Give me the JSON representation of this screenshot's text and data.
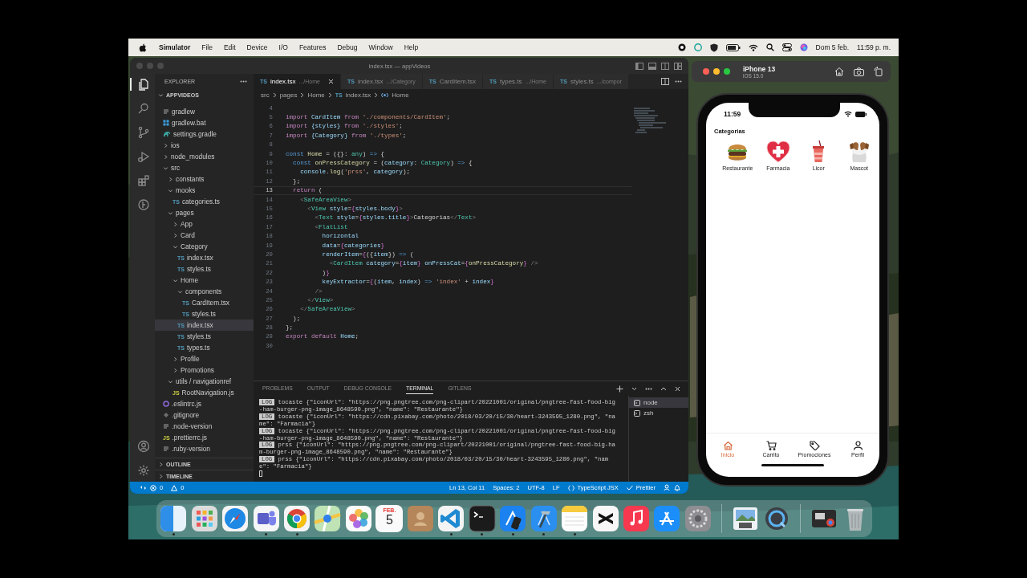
{
  "menubar": {
    "app": "Simulator",
    "menus": [
      "File",
      "Edit",
      "Device",
      "I/O",
      "Features",
      "Debug",
      "Window",
      "Help"
    ],
    "date": "Dom 5 feb.",
    "time": "11:59 p. m."
  },
  "vscode": {
    "title": "index.tsx — appVideos",
    "activity": {
      "top": [
        {
          "kind": "files",
          "selected": true
        },
        {
          "kind": "search",
          "selected": false
        },
        {
          "kind": "source-control",
          "selected": false
        },
        {
          "kind": "run",
          "selected": false
        },
        {
          "kind": "extensions",
          "selected": false
        },
        {
          "kind": "gitlens",
          "selected": false
        }
      ],
      "bottom": [
        {
          "kind": "account",
          "selected": false
        },
        {
          "kind": "settings",
          "selected": false
        }
      ]
    },
    "explorer": {
      "title": "EXPLORER",
      "root": {
        "label": "APPVIDEOS",
        "expanded": true
      },
      "items": [
        {
          "label": "gradlew",
          "kind": "text",
          "selected": false
        },
        {
          "label": "gradlew.bat",
          "kind": "windows",
          "selected": false
        },
        {
          "label": "settings.gradle",
          "kind": "gradle",
          "selected": false
        },
        {
          "label": "ios",
          "kind": "folder",
          "expanded": false,
          "selected": false
        },
        {
          "label": "node_modules",
          "kind": "folder",
          "expanded": false,
          "selected": false
        },
        {
          "label": "src",
          "kind": "folder",
          "expanded": true,
          "selected": false,
          "children": [
            {
              "label": "constants",
              "kind": "folder",
              "expanded": false,
              "selected": false
            },
            {
              "label": "mooks",
              "kind": "folder",
              "expanded": true,
              "selected": false,
              "children": [
                {
                  "label": "categories.ts",
                  "kind": "ts",
                  "badge": "TS",
                  "selected": false
                }
              ]
            },
            {
              "label": "pages",
              "kind": "folder",
              "expanded": true,
              "selected": false,
              "children": [
                {
                  "label": "App",
                  "kind": "folder",
                  "expanded": false,
                  "selected": false
                },
                {
                  "label": "Card",
                  "kind": "folder",
                  "expanded": false,
                  "selected": false
                },
                {
                  "label": "Category",
                  "kind": "folder",
                  "expanded": true,
                  "selected": false,
                  "children": [
                    {
                      "label": "index.tsx",
                      "kind": "ts",
                      "badge": "TS",
                      "selected": false
                    },
                    {
                      "label": "styles.ts",
                      "kind": "ts",
                      "badge": "TS",
                      "selected": false
                    }
                  ]
                },
                {
                  "label": "Home",
                  "kind": "folder",
                  "expanded": true,
                  "selected": false,
                  "children": [
                    {
                      "label": "components",
                      "kind": "folder",
                      "expanded": true,
                      "selected": false,
                      "children": [
                        {
                          "label": "CardItem.tsx",
                          "kind": "ts",
                          "badge": "TS",
                          "selected": false
                        },
                        {
                          "label": "styles.ts",
                          "kind": "ts",
                          "badge": "TS",
                          "selected": false
                        }
                      ]
                    },
                    {
                      "label": "index.tsx",
                      "kind": "ts",
                      "badge": "TS",
                      "selected": true
                    },
                    {
                      "label": "styles.ts",
                      "kind": "ts",
                      "badge": "TS",
                      "selected": false
                    },
                    {
                      "label": "types.ts",
                      "kind": "ts",
                      "badge": "TS",
                      "selected": false
                    }
                  ]
                },
                {
                  "label": "Profile",
                  "kind": "folder",
                  "expanded": false,
                  "selected": false
                },
                {
                  "label": "Promotions",
                  "kind": "folder",
                  "expanded": false,
                  "selected": false
                }
              ]
            },
            {
              "label": "utils / navigationref",
              "kind": "folder",
              "expanded": true,
              "selected": false,
              "children": [
                {
                  "label": "RootNavigation.js",
                  "kind": "js",
                  "badge": "JS",
                  "selected": false
                }
              ]
            }
          ]
        },
        {
          "label": ".eslintrc.js",
          "kind": "eslint",
          "selected": false
        },
        {
          "label": ".gitignore",
          "kind": "git",
          "selected": false
        },
        {
          "label": ".node-version",
          "kind": "text",
          "selected": false
        },
        {
          "label": ".prettierrc.js",
          "kind": "js",
          "badge": "JS",
          "selected": false
        },
        {
          "label": ".ruby-version",
          "kind": "text",
          "selected": false
        }
      ],
      "sections": [
        {
          "label": "OUTLINE",
          "expanded": false
        },
        {
          "label": "TIMELINE",
          "expanded": false
        }
      ]
    },
    "tabs": [
      {
        "badge": "TS",
        "label": "index.tsx",
        "detail": ".../Home",
        "selected": true
      },
      {
        "badge": "TS",
        "label": "index.tsx",
        "detail": ".../Category",
        "selected": false
      },
      {
        "badge": "TS",
        "label": "CardItem.tsx",
        "selected": false
      },
      {
        "badge": "TS",
        "label": "types.ts",
        "detail": ".../Home",
        "selected": false
      },
      {
        "badge": "TS",
        "label": "styles.ts",
        "detail": ".../compor",
        "selected": false
      }
    ],
    "breadcrumb": [
      {
        "label": "src",
        "kind": "folder"
      },
      {
        "label": "pages",
        "kind": "folder"
      },
      {
        "label": "Home",
        "kind": "folder"
      },
      {
        "label": "index.tsx",
        "kind": "file",
        "badge": "TS"
      },
      {
        "label": "Home",
        "kind": "symbol"
      }
    ],
    "code": [
      {
        "number": "4",
        "current": false
      },
      {
        "number": "5",
        "current": false,
        "tokens": [
          {
            "text": "import ",
            "kind": "kw"
          },
          {
            "text": "CardItem ",
            "kind": "var"
          },
          {
            "text": "from ",
            "kind": "kw"
          },
          {
            "text": "'./components/CardItem'",
            "kind": "str"
          },
          {
            "text": ";",
            "kind": "txt"
          }
        ]
      },
      {
        "number": "6",
        "current": false,
        "tokens": [
          {
            "text": "import ",
            "kind": "kw"
          },
          {
            "text": "{styles} ",
            "kind": "var"
          },
          {
            "text": "from ",
            "kind": "kw"
          },
          {
            "text": "'./styles'",
            "kind": "str"
          },
          {
            "text": ";",
            "kind": "txt"
          }
        ]
      },
      {
        "number": "7",
        "current": false,
        "tokens": [
          {
            "text": "import ",
            "kind": "kw"
          },
          {
            "text": "{Category} ",
            "kind": "var"
          },
          {
            "text": "from ",
            "kind": "kw"
          },
          {
            "text": "'./types'",
            "kind": "str"
          },
          {
            "text": ";",
            "kind": "txt"
          }
        ]
      },
      {
        "number": "8",
        "current": false
      },
      {
        "number": "9",
        "current": false,
        "tokens": [
          {
            "text": "const ",
            "kind": "st"
          },
          {
            "text": "Home",
            "kind": "fn"
          },
          {
            "text": " = ({}: ",
            "kind": "txt"
          },
          {
            "text": "any",
            "kind": "type"
          },
          {
            "text": ") ",
            "kind": "txt"
          },
          {
            "text": "=>",
            "kind": "st"
          },
          {
            "text": " {",
            "kind": "txt"
          }
        ]
      },
      {
        "number": "10",
        "current": false,
        "tokens": [
          {
            "text": "  const ",
            "kind": "st"
          },
          {
            "text": "onPressCategory",
            "kind": "fn"
          },
          {
            "text": " = (",
            "kind": "txt"
          },
          {
            "text": "category",
            "kind": "var"
          },
          {
            "text": ": ",
            "kind": "txt"
          },
          {
            "text": "Category",
            "kind": "type"
          },
          {
            "text": ") ",
            "kind": "txt"
          },
          {
            "text": "=>",
            "kind": "st"
          },
          {
            "text": " {",
            "kind": "txt"
          }
        ]
      },
      {
        "number": "11",
        "current": false,
        "tokens": [
          {
            "text": "    console",
            "kind": "var"
          },
          {
            "text": ".",
            "kind": "txt"
          },
          {
            "text": "log",
            "kind": "fn"
          },
          {
            "text": "(",
            "kind": "txt"
          },
          {
            "text": "'prss'",
            "kind": "str"
          },
          {
            "text": ", ",
            "kind": "txt"
          },
          {
            "text": "category",
            "kind": "var"
          },
          {
            "text": ");",
            "kind": "txt"
          }
        ]
      },
      {
        "number": "12",
        "current": false,
        "tokens": [
          {
            "text": "  };",
            "kind": "txt"
          }
        ]
      },
      {
        "number": "13",
        "current": true,
        "tokens": [
          {
            "text": "  return ",
            "kind": "kw"
          },
          {
            "text": "(",
            "kind": "txt"
          }
        ]
      },
      {
        "number": "14",
        "current": false,
        "tokens": [
          {
            "text": "    <",
            "kind": "pun"
          },
          {
            "text": "SafeAreaView",
            "kind": "type"
          },
          {
            "text": ">",
            "kind": "pun"
          }
        ]
      },
      {
        "number": "15",
        "current": false,
        "tokens": [
          {
            "text": "      <",
            "kind": "pun"
          },
          {
            "text": "View ",
            "kind": "type"
          },
          {
            "text": "style",
            "kind": "var"
          },
          {
            "text": "=",
            "kind": "txt"
          },
          {
            "text": "{",
            "kind": "br"
          },
          {
            "text": "styles.body",
            "kind": "var"
          },
          {
            "text": "}",
            "kind": "br"
          },
          {
            "text": ">",
            "kind": "pun"
          }
        ]
      },
      {
        "number": "16",
        "current": false,
        "tokens": [
          {
            "text": "        <",
            "kind": "pun"
          },
          {
            "text": "Text ",
            "kind": "type"
          },
          {
            "text": "style",
            "kind": "var"
          },
          {
            "text": "=",
            "kind": "txt"
          },
          {
            "text": "{",
            "kind": "br"
          },
          {
            "text": "styles.title",
            "kind": "var"
          },
          {
            "text": "}",
            "kind": "br"
          },
          {
            "text": ">",
            "kind": "pun"
          },
          {
            "text": "Categorias",
            "kind": "txt"
          },
          {
            "text": "</",
            "kind": "pun"
          },
          {
            "text": "Text",
            "kind": "type"
          },
          {
            "text": ">",
            "kind": "pun"
          }
        ]
      },
      {
        "number": "17",
        "current": false,
        "tokens": [
          {
            "text": "        <",
            "kind": "pun"
          },
          {
            "text": "FlatList",
            "kind": "type"
          }
        ]
      },
      {
        "number": "18",
        "current": false,
        "tokens": [
          {
            "text": "          horizontal",
            "kind": "var"
          }
        ]
      },
      {
        "number": "19",
        "current": false,
        "tokens": [
          {
            "text": "          data",
            "kind": "var"
          },
          {
            "text": "=",
            "kind": "txt"
          },
          {
            "text": "{",
            "kind": "br"
          },
          {
            "text": "categories",
            "kind": "var"
          },
          {
            "text": "}",
            "kind": "br"
          }
        ]
      },
      {
        "number": "20",
        "current": false,
        "tokens": [
          {
            "text": "          renderItem",
            "kind": "var"
          },
          {
            "text": "=",
            "kind": "txt"
          },
          {
            "text": "{",
            "kind": "br"
          },
          {
            "text": "({",
            "kind": "txt"
          },
          {
            "text": "item",
            "kind": "var"
          },
          {
            "text": "}) ",
            "kind": "txt"
          },
          {
            "text": "=>",
            "kind": "st"
          },
          {
            "text": " (",
            "kind": "txt"
          }
        ]
      },
      {
        "number": "21",
        "current": false,
        "tokens": [
          {
            "text": "            <",
            "kind": "pun"
          },
          {
            "text": "CardItem ",
            "kind": "type"
          },
          {
            "text": "category",
            "kind": "var"
          },
          {
            "text": "=",
            "kind": "txt"
          },
          {
            "text": "{",
            "kind": "br"
          },
          {
            "text": "item",
            "kind": "var"
          },
          {
            "text": "} ",
            "kind": "br"
          },
          {
            "text": "onPressCat",
            "kind": "var"
          },
          {
            "text": "=",
            "kind": "txt"
          },
          {
            "text": "{",
            "kind": "br"
          },
          {
            "text": "onPressCategory",
            "kind": "fn"
          },
          {
            "text": "} ",
            "kind": "br"
          },
          {
            "text": "/>",
            "kind": "pun"
          }
        ]
      },
      {
        "number": "22",
        "current": false,
        "tokens": [
          {
            "text": "          )",
            "kind": "txt"
          },
          {
            "text": "}",
            "kind": "br"
          }
        ]
      },
      {
        "number": "23",
        "current": false,
        "tokens": [
          {
            "text": "          keyExtractor",
            "kind": "var"
          },
          {
            "text": "=",
            "kind": "txt"
          },
          {
            "text": "{",
            "kind": "br"
          },
          {
            "text": "(",
            "kind": "txt"
          },
          {
            "text": "item",
            "kind": "var"
          },
          {
            "text": ", ",
            "kind": "txt"
          },
          {
            "text": "index",
            "kind": "var"
          },
          {
            "text": ") ",
            "kind": "txt"
          },
          {
            "text": "=> ",
            "kind": "st"
          },
          {
            "text": "'index'",
            "kind": "str"
          },
          {
            "text": " + ",
            "kind": "txt"
          },
          {
            "text": "index",
            "kind": "var"
          },
          {
            "text": "}",
            "kind": "br"
          }
        ]
      },
      {
        "number": "24",
        "current": false,
        "tokens": [
          {
            "text": "        />",
            "kind": "pun"
          }
        ]
      },
      {
        "number": "25",
        "current": false,
        "tokens": [
          {
            "text": "      </",
            "kind": "pun"
          },
          {
            "text": "View",
            "kind": "type"
          },
          {
            "text": ">",
            "kind": "pun"
          }
        ]
      },
      {
        "number": "26",
        "current": false,
        "tokens": [
          {
            "text": "    </",
            "kind": "pun"
          },
          {
            "text": "SafeAreaView",
            "kind": "type"
          },
          {
            "text": ">",
            "kind": "pun"
          }
        ]
      },
      {
        "number": "27",
        "current": false,
        "tokens": [
          {
            "text": "  );",
            "kind": "txt"
          }
        ]
      },
      {
        "number": "28",
        "current": false,
        "tokens": [
          {
            "text": "};",
            "kind": "txt"
          }
        ]
      },
      {
        "number": "29",
        "current": false,
        "tokens": [
          {
            "text": "export default ",
            "kind": "kw"
          },
          {
            "text": "Home",
            "kind": "var"
          },
          {
            "text": ";",
            "kind": "txt"
          }
        ]
      },
      {
        "number": "30",
        "current": false
      }
    ],
    "panel": {
      "tabs": [
        {
          "label": "PROBLEMS",
          "selected": false
        },
        {
          "label": "OUTPUT",
          "selected": false
        },
        {
          "label": "DEBUG CONSOLE",
          "selected": false
        },
        {
          "label": "TERMINAL",
          "selected": true
        },
        {
          "label": "GITLENS",
          "selected": false
        }
      ],
      "log": [
        {
          "badge": "LOG",
          "message": "tocaste {\"iconUrl\": \"https://png.pngtree.com/png-clipart/20221001/original/pngtree-fast-food-big-ham-burger-png-image_8648590.png\", \"name\": \"Restaurante\"}"
        },
        {
          "badge": "LOG",
          "message": "tocaste {\"iconUrl\": \"https://cdn.pixabay.com/photo/2018/03/20/15/30/heart-3243595_1280.png\", \"name\": \"Farmacia\"}"
        },
        {
          "badge": "LOG",
          "message": "tocaste {\"iconUrl\": \"https://png.pngtree.com/png-clipart/20221001/original/pngtree-fast-food-big-ham-burger-png-image_8648590.png\", \"name\": \"Restaurante\"}"
        },
        {
          "badge": "LOG",
          "message": "prss {\"iconUrl\": \"https://png.pngtree.com/png-clipart/20221001/original/pngtree-fast-food-big-ham-burger-png-image_8648590.png\", \"name\": \"Restaurante\"}"
        },
        {
          "badge": "LOG",
          "message": "prss {\"iconUrl\": \"https://cdn.pixabay.com/photo/2018/03/20/15/30/heart-3243595_1280.png\", \"name\": \"Farmacia\"}"
        }
      ],
      "terminals": [
        {
          "label": "node",
          "selected": true
        },
        {
          "label": "zsh",
          "selected": false
        }
      ]
    },
    "status": {
      "errors": "0",
      "warnings": "0",
      "items": [
        {
          "text": "Ln 13, Col 11",
          "kind": "plain"
        },
        {
          "text": "Spaces: 2",
          "kind": "plain"
        },
        {
          "text": "UTF-8",
          "kind": "plain"
        },
        {
          "text": "LF",
          "kind": "plain"
        },
        {
          "text": "TypeScript JSX",
          "kind": "language"
        },
        {
          "text": "Prettier",
          "kind": "formatter"
        }
      ]
    }
  },
  "simulator": {
    "title": "iPhone 13",
    "subtitle": "iOS 15.0",
    "time": "11:59",
    "heading": "Categorias",
    "categories": [
      {
        "label": "Restaurante",
        "kind": "burger"
      },
      {
        "label": "Farmacia",
        "kind": "heart"
      },
      {
        "label": "Licor",
        "kind": "cup"
      },
      {
        "label": "Mascot",
        "kind": "dog"
      }
    ],
    "tabs": [
      {
        "label": "Inicio",
        "kind": "home",
        "selected": true
      },
      {
        "label": "Carrito",
        "kind": "cart",
        "selected": false
      },
      {
        "label": "Promociones",
        "kind": "tag",
        "selected": false
      },
      {
        "label": "Perfil",
        "kind": "person",
        "selected": false
      }
    ]
  },
  "dock": {
    "sections": [
      {
        "items": [
          {
            "kind": "finder",
            "running": true
          },
          {
            "kind": "launchpad",
            "running": false
          },
          {
            "kind": "safari",
            "running": false
          },
          {
            "kind": "teams",
            "running": true
          },
          {
            "kind": "chrome",
            "running": true
          },
          {
            "kind": "maps",
            "running": false
          },
          {
            "kind": "photos",
            "running": false
          },
          {
            "kind": "calendar",
            "month": "FEB.",
            "day": "5",
            "running": false
          },
          {
            "kind": "contacts",
            "running": false
          },
          {
            "kind": "vscode",
            "running": true
          },
          {
            "kind": "terminal",
            "running": true
          },
          {
            "kind": "simulator",
            "running": true
          },
          {
            "kind": "xcode",
            "running": true
          },
          {
            "kind": "notes",
            "running": true
          },
          {
            "kind": "capcut",
            "running": false
          },
          {
            "kind": "music",
            "running": false
          },
          {
            "kind": "appstore",
            "running": false
          },
          {
            "kind": "settings",
            "running": false
          }
        ]
      },
      {
        "items": [
          {
            "kind": "preview",
            "running": false
          },
          {
            "kind": "quicktime",
            "running": false
          }
        ]
      },
      {
        "items": [
          {
            "kind": "stack",
            "running": false
          },
          {
            "kind": "trash",
            "running": false
          }
        ]
      }
    ]
  }
}
